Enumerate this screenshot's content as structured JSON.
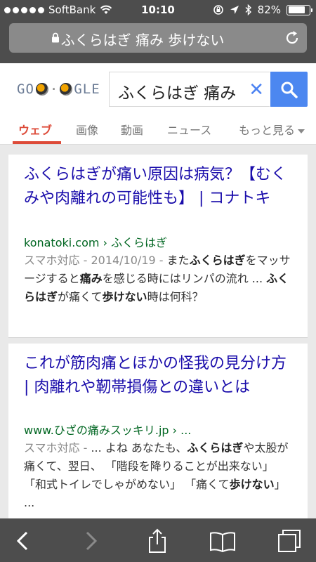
{
  "status": {
    "carrier": "SoftBank",
    "time": "10:10",
    "battery": "82%",
    "battery_level": 0.82
  },
  "address_bar": {
    "url_text": "ふくらはぎ 痛み 歩けない"
  },
  "header": {
    "logo_text_left": "GO",
    "logo_text_right": "GLE",
    "search_query": "ふくらはぎ 痛み",
    "tabs": [
      "ウェブ",
      "画像",
      "動画",
      "ニュース",
      "もっと見る"
    ]
  },
  "results": [
    {
      "title": "ふくらはぎが痛い原因は病気？【むくみや肉離れの可能性も】 | コナトキ",
      "url": "konatoki.com › ふくらはぎ",
      "meta": "スマホ対応 - 2014/10/19 - ",
      "snippet_parts": [
        "また",
        "ふくらはぎ",
        "をマッサージすると",
        "痛み",
        "を感じる時にはリンパの流れ ... ",
        "ふくらはぎ",
        "が痛くて",
        "歩けない",
        "時は何科？"
      ]
    },
    {
      "title": "これが筋肉痛とほかの怪我の見分け方 | 肉離れや靭帯損傷との違いとは",
      "url": "www.ひざの痛みスッキリ.jp › ...",
      "meta": "スマホ対応 - ",
      "snippet_parts": [
        "... よね あなたも、",
        "ふくらはぎ",
        "や太股が痛くて、翌日、 「階段を降りることが出来ない」 「和式トイレでしゃがめない」 「痛くて",
        "歩けない",
        "」 ..."
      ]
    }
  ]
}
